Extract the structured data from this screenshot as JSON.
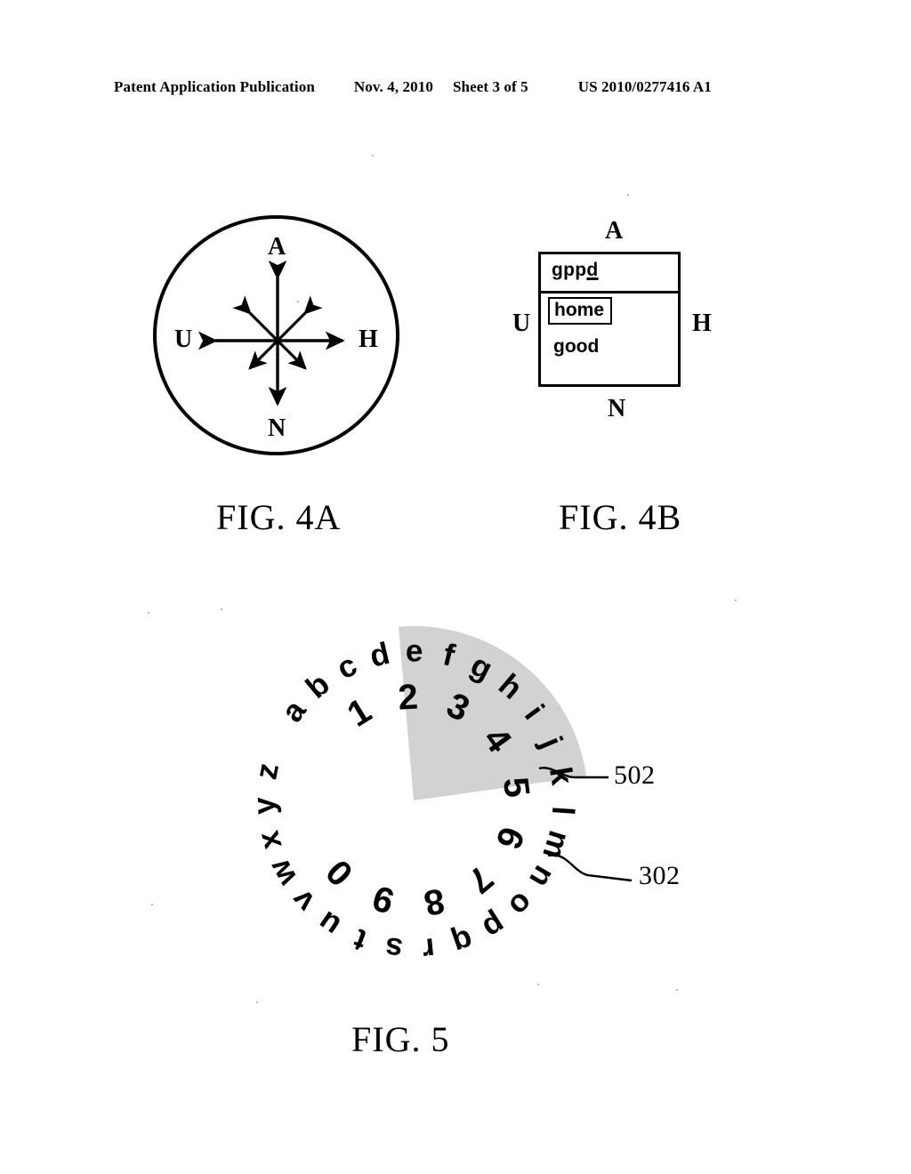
{
  "header": {
    "publication": "Patent Application Publication",
    "date": "Nov. 4, 2010",
    "sheet": "Sheet 3 of 5",
    "patent_number": "US 2010/0277416 A1"
  },
  "figures": [
    {
      "id": "fig4a",
      "caption": "FIG. 4A",
      "type": "circle-compass",
      "description": "Circle containing an eight-direction arrow rose",
      "edge_labels": {
        "top": "A",
        "left": "U",
        "right": "H",
        "bottom": "N"
      },
      "directions": [
        "up",
        "up-right",
        "right",
        "down-right",
        "down",
        "down-left",
        "left",
        "up-left"
      ]
    },
    {
      "id": "fig4b",
      "caption": "FIG. 4B",
      "type": "rectangle-list",
      "description": "Rectangular panel with a typed string and a candidate word list",
      "edge_labels": {
        "top": "A",
        "left": "U",
        "right": "H",
        "bottom": "N"
      },
      "typed_text": "gpp",
      "typed_caret_char": "d",
      "candidates": [
        {
          "label": "home",
          "selected": true
        },
        {
          "label": "good",
          "selected": false
        }
      ]
    },
    {
      "id": "fig5",
      "caption": "FIG. 5",
      "type": "radial-dial",
      "description": "Two concentric rings of characters with a highlighted sector",
      "outer_ring_label": "302",
      "highlight_label": "502",
      "outer_ring_chars": [
        "a",
        "b",
        "c",
        "d",
        "e",
        "f",
        "g",
        "h",
        "i",
        "j",
        "k",
        "l",
        "m",
        "n",
        "o",
        "p",
        "q",
        "r",
        "s",
        "t",
        "u",
        "v",
        "w",
        "x",
        "y",
        "z"
      ],
      "inner_ring_chars": [
        "1",
        "2",
        "3",
        "4",
        "5",
        "6",
        "7",
        "8",
        "9",
        "0"
      ],
      "highlight_sector": {
        "start_angle_deg": -95,
        "end_angle_deg": -8,
        "color": "#d2d2d2"
      },
      "reference_numerals": [
        {
          "value": "502",
          "points_to": "highlighted sector"
        },
        {
          "value": "302",
          "points_to": "outer character ring"
        }
      ]
    }
  ],
  "colors": {
    "ink": "#000000",
    "page": "#ffffff",
    "highlight": "#d2d2d2",
    "speckle": "#b9b9b9"
  }
}
